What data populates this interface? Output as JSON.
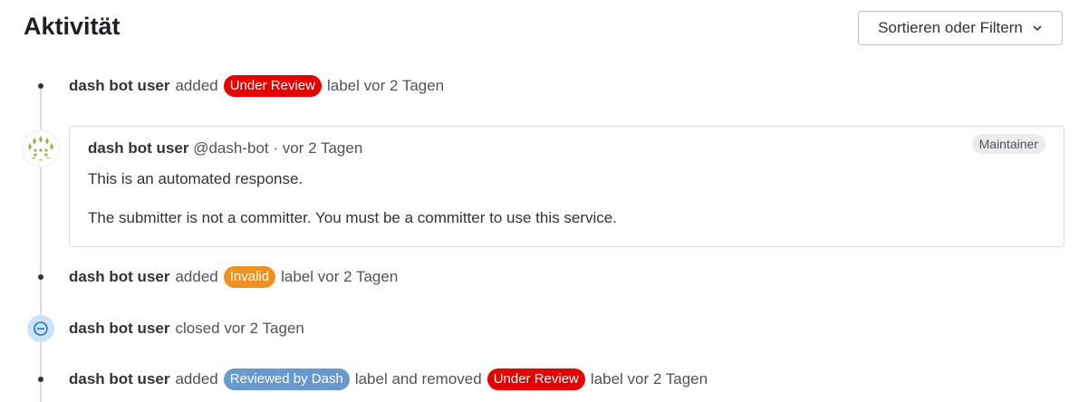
{
  "header": {
    "title": "Aktivität",
    "sort_button_label": "Sortieren oder Filtern"
  },
  "events": [
    {
      "author": "dash bot user",
      "pre": "added",
      "label": "Under Review",
      "label_color": "#e60000",
      "post": "label vor 2 Tagen"
    },
    {
      "author": "dash bot user",
      "pre": "added",
      "label": "Invalid",
      "label_color": "#ed9121",
      "post": "label vor 2 Tagen"
    },
    {
      "author": "dash bot user",
      "text": "closed vor 2 Tagen"
    },
    {
      "author": "dash bot user",
      "pre": "added",
      "label": "Reviewed by Dash",
      "label_color": "#6699cc",
      "mid": "label and removed",
      "label2": "Under Review",
      "label2_color": "#e60000",
      "post": "label vor 2 Tagen"
    }
  ],
  "note": {
    "author": "dash bot user",
    "handle": "@dash-bot",
    "separator": "·",
    "time": "vor 2 Tagen",
    "role": "Maintainer",
    "paragraphs": [
      "This is an automated response.",
      "The submitter is not a committer. You must be a committer to use this service."
    ]
  },
  "icons": {
    "sort": "chevron-down-icon",
    "closed": "closed-issue-icon",
    "avatar": "identicon-avatar"
  },
  "colors": {
    "accent_blue": "#1f75cb",
    "closed_bg": "#cbe2f9"
  }
}
